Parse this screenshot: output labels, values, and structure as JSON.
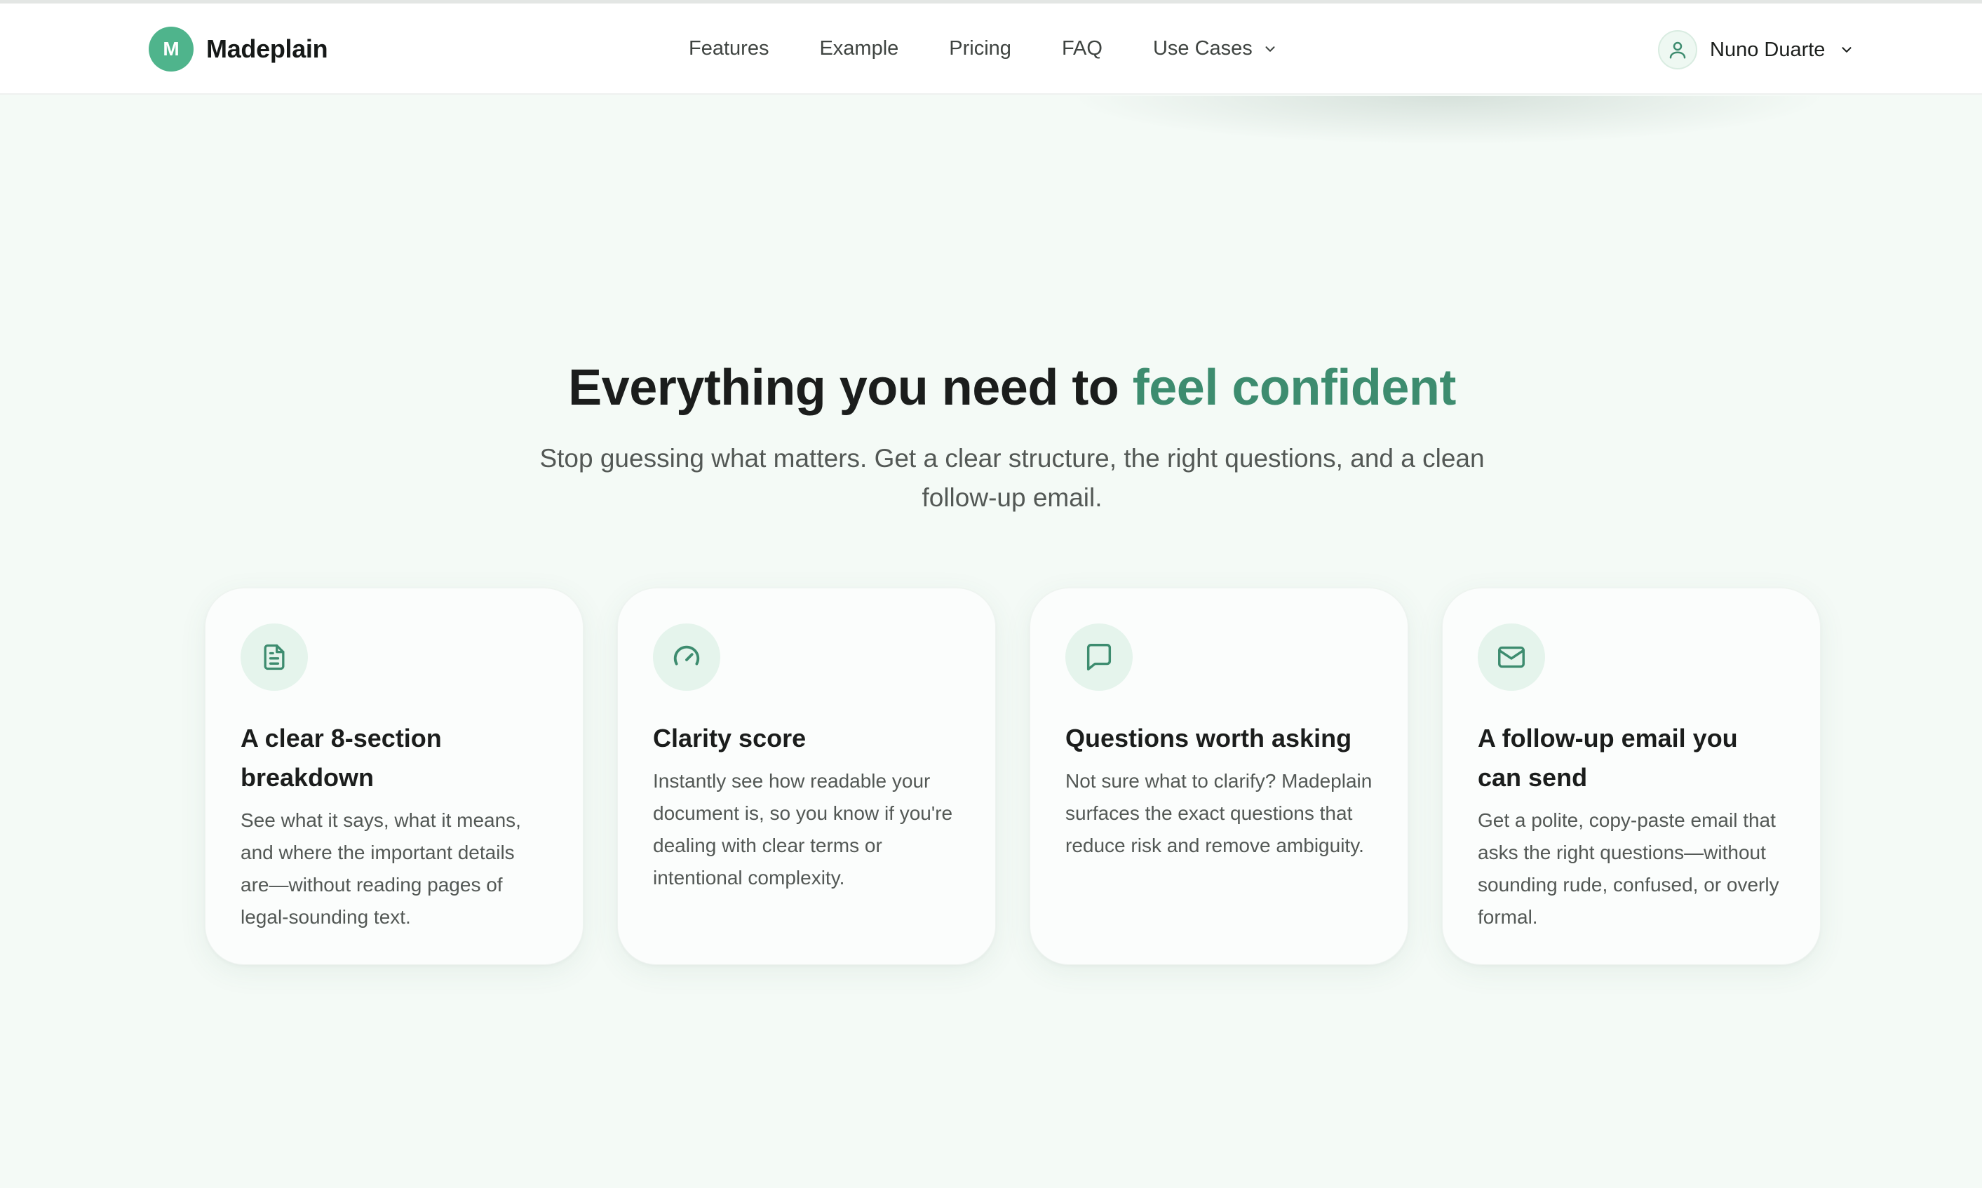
{
  "brand": {
    "logo_letter": "M",
    "name": "Madeplain",
    "accent_color": "#4fb48c"
  },
  "nav": {
    "links": [
      "Features",
      "Example",
      "Pricing",
      "FAQ"
    ],
    "dropdown_label": "Use Cases"
  },
  "user": {
    "name": "Nuno Duarte",
    "icon": "user-icon"
  },
  "hero": {
    "title_plain": "Everything you need to ",
    "title_accent": "feel confident",
    "accent_color": "#3d8c6f",
    "subtitle": "Stop guessing what matters. Get a clear structure, the right questions, and a clean follow-up email."
  },
  "features": [
    {
      "icon": "document-icon",
      "title": "A clear 8-section breakdown",
      "text": "See what it says, what it means, and where the important details are—without reading pages of legal-sounding text."
    },
    {
      "icon": "gauge-icon",
      "title": "Clarity score",
      "text": "Instantly see how readable your document is, so you know if you're dealing with clear terms or intentional complexity."
    },
    {
      "icon": "message-icon",
      "title": "Questions worth asking",
      "text": "Not sure what to clarify? Madeplain surfaces the exact questions that reduce risk and remove ambiguity."
    },
    {
      "icon": "mail-icon",
      "title": "A follow-up email you can send",
      "text": "Get a polite, copy-paste email that asks the right questions—without sounding rude, confused, or overly formal."
    }
  ]
}
